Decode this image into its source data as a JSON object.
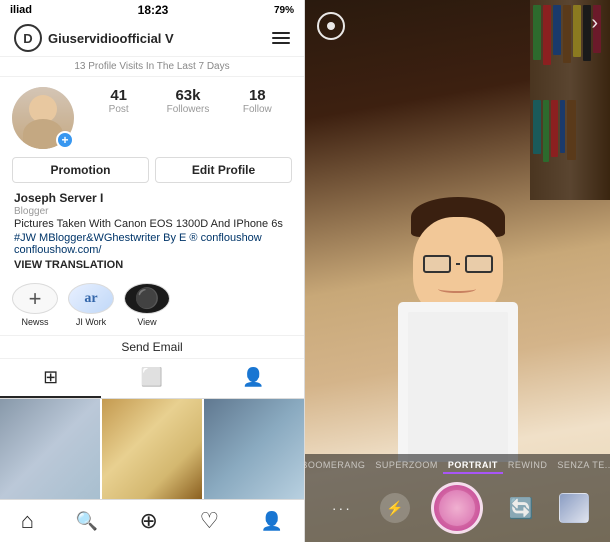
{
  "left": {
    "statusBar": {
      "carrier": "iliad",
      "signal": "▲",
      "time": "18:23",
      "battery": "79%"
    },
    "header": {
      "logo": "D",
      "username": "Giuservidioofficial V",
      "menu": "☰"
    },
    "visits": "13 Profile Visits In The Last 7 Days",
    "stats": {
      "posts": {
        "number": "41",
        "label": "Post"
      },
      "followers": {
        "number": "63k",
        "label": "Followers"
      },
      "following": {
        "number": "18",
        "label": "Follow"
      }
    },
    "buttons": {
      "promotion": "Promotion",
      "editProfile": "Edit Profile"
    },
    "profile": {
      "name": "Joseph Server I",
      "category": "Blogger",
      "bio": "Pictures Taken With Canon EOS 1300D And IPhone 6s",
      "hashtag": "#JW MBlogger&WGhestwriter By E ® confloushow",
      "website": "confloushow.com/"
    },
    "translation": "VIEW TRANSLATION",
    "highlights": [
      {
        "type": "add",
        "label": "Newss"
      },
      {
        "type": "circle",
        "label": "JI Work"
      },
      {
        "type": "lens",
        "label": "View"
      }
    ],
    "sendEmail": "Send Email",
    "tabs": [
      {
        "icon": "⊞",
        "active": true
      },
      {
        "icon": "⬜",
        "active": false
      },
      {
        "icon": "👤",
        "active": false
      }
    ],
    "nav": [
      {
        "icon": "⌂",
        "label": "home"
      },
      {
        "icon": "🔍",
        "label": "search"
      },
      {
        "icon": "⊕",
        "label": "add"
      },
      {
        "icon": "♡",
        "label": "activity"
      },
      {
        "icon": "👤",
        "label": "profile"
      }
    ]
  },
  "right": {
    "modes": [
      {
        "label": "BOOMERANG",
        "active": false
      },
      {
        "label": "SUPERZOOM",
        "active": false
      },
      {
        "label": "PORTRAIT",
        "active": true
      },
      {
        "label": "REWIND",
        "active": false
      },
      {
        "label": "SENZA TE...",
        "active": false
      }
    ]
  }
}
